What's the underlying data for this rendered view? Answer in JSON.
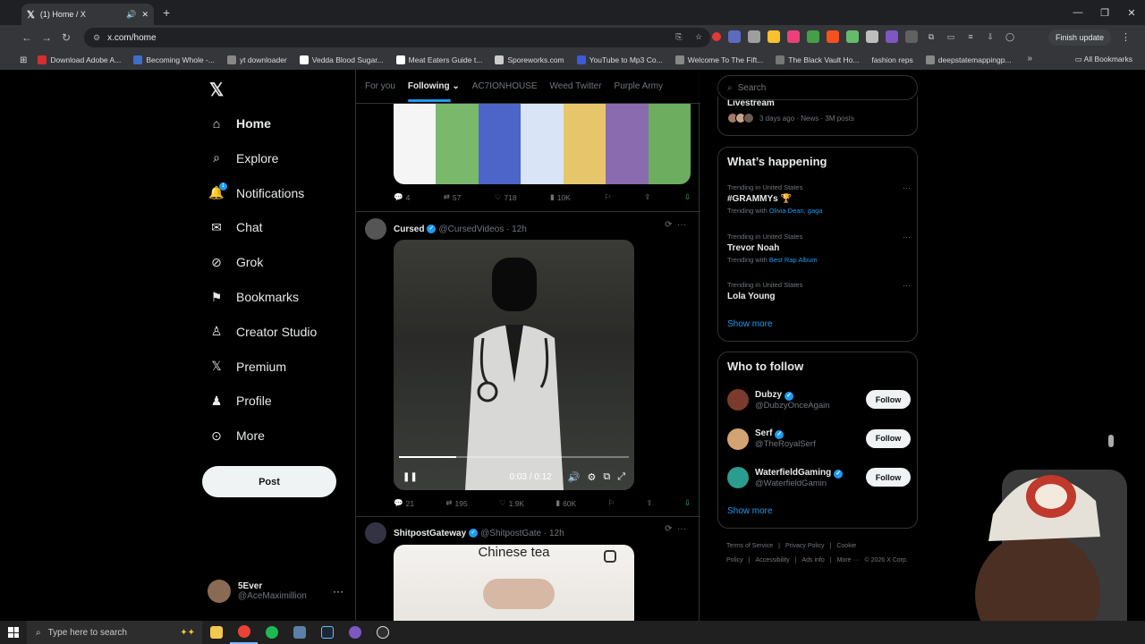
{
  "browser": {
    "tab_title": "(1) Home / X",
    "url": "x.com/home",
    "finish_update_label": "Finish update",
    "bookmarks": [
      {
        "label": "Download Adobe A...",
        "color": "#d32f2f"
      },
      {
        "label": "Becoming Whole -...",
        "color": "#3f6ec9"
      },
      {
        "label": "yt downloader",
        "color": "#888888"
      },
      {
        "label": "Vedda Blood Sugar...",
        "color": "#ffffff"
      },
      {
        "label": "Meat Eaters Guide t...",
        "color": "#ffffff"
      },
      {
        "label": "Sporeworks.com",
        "color": "#cccccc"
      },
      {
        "label": "YouTube to Mp3 Co...",
        "color": "#3b5bdb"
      },
      {
        "label": "Welcome To The Fift...",
        "color": "#888888"
      },
      {
        "label": "The Black Vault Ho...",
        "color": "#777777"
      },
      {
        "label": "fashion reps",
        "color": ""
      },
      {
        "label": "deepstatemappingp...",
        "color": "#888888"
      }
    ],
    "all_bookmarks_label": "All Bookmarks"
  },
  "sidebar": {
    "items": [
      {
        "label": "Home",
        "icon": "home-icon"
      },
      {
        "label": "Explore",
        "icon": "search-icon"
      },
      {
        "label": "Notifications",
        "icon": "bell-icon",
        "badge": "1"
      },
      {
        "label": "Chat",
        "icon": "mail-icon"
      },
      {
        "label": "Grok",
        "icon": "grok-icon"
      },
      {
        "label": "Bookmarks",
        "icon": "bookmark-icon"
      },
      {
        "label": "Creator Studio",
        "icon": "creator-studio-icon"
      },
      {
        "label": "Premium",
        "icon": "x-premium-icon"
      },
      {
        "label": "Profile",
        "icon": "profile-icon"
      },
      {
        "label": "More",
        "icon": "more-circle-icon"
      }
    ],
    "post_label": "Post",
    "account": {
      "name": "5Ever",
      "handle": "@AceMaximillion"
    }
  },
  "timeline": {
    "tabs": [
      "For you",
      "Following",
      "AC7IONHOUSE",
      "Weed Twitter",
      "Purple Army"
    ],
    "active_tab": "Following",
    "post1_stats": {
      "replies": "4",
      "reposts": "57",
      "likes": "718",
      "views": "10K"
    },
    "post2": {
      "name": "Cursed",
      "handle": "@CursedVideos",
      "time": "12h",
      "video_time": "0:03 / 0:12",
      "progress": 0.25,
      "stats": {
        "replies": "21",
        "reposts": "195",
        "likes": "1.9K",
        "views": "60K"
      }
    },
    "post3": {
      "name": "ShitpostGateway",
      "handle": "@ShitpostGate",
      "time": "12h",
      "image_caption": "Chinese tea"
    }
  },
  "right": {
    "search_placeholder": "Search",
    "live": {
      "title": "Livestream",
      "meta": "3 days ago · News · 3M posts"
    },
    "whats_happening_title": "What’s happening",
    "trends": [
      {
        "meta": "Trending in United States",
        "name": "#GRAMMYs 🏆",
        "with_prefix": "Trending with",
        "with": "Olivia Dean, gaga"
      },
      {
        "meta": "Trending in United States",
        "name": "Trevor Noah",
        "with_prefix": "Trending with",
        "with": "Best Rap Album"
      },
      {
        "meta": "Trending in United States",
        "name": "Lola Young",
        "with_prefix": "",
        "with": ""
      }
    ],
    "show_more": "Show more",
    "who_to_follow_title": "Who to follow",
    "follow_label": "Follow",
    "suggestions": [
      {
        "name": "Dubzy",
        "handle": "@DubzyOnceAgain"
      },
      {
        "name": "Serf",
        "handle": "@TheRoyalSerf"
      },
      {
        "name": "WaterfieldGaming",
        "handle": "@WaterfieldGamin"
      }
    ],
    "footer_links": [
      "Terms of Service",
      "|",
      "Privacy Policy",
      "|",
      "Cookie Policy",
      "|",
      "Accessibility",
      "|",
      "Ads info",
      "|",
      "More ···",
      "© 2026 X Corp."
    ]
  },
  "taskbar": {
    "search_placeholder": "Type here to search"
  }
}
